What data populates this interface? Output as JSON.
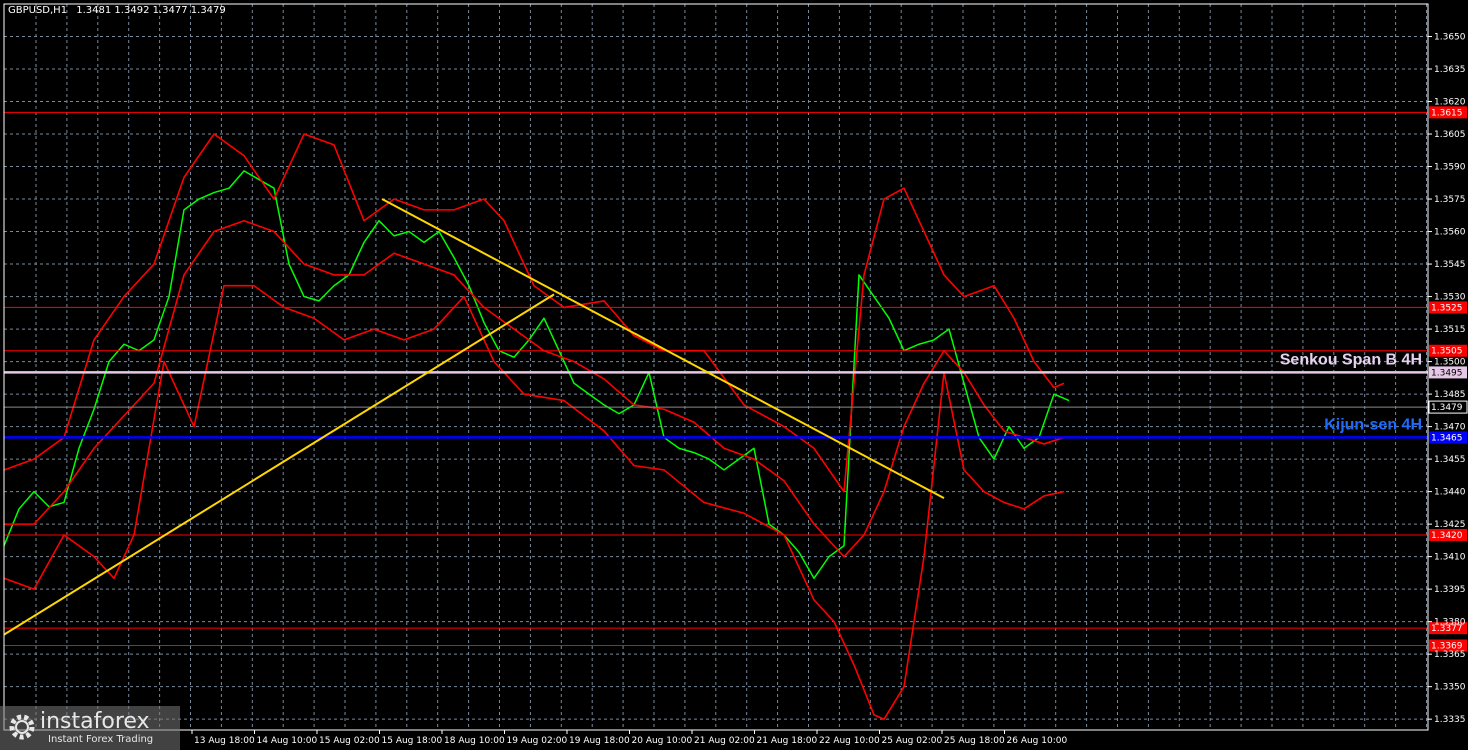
{
  "header": {
    "symbol": "GBPUSD,H1",
    "ohlc": "1.3481 1.3492 1.3477 1.3479"
  },
  "watermark": {
    "brand": "instaforex",
    "tagline": "Instant Forex Trading",
    "icon": "gear-logo-icon"
  },
  "chart_data": {
    "type": "line",
    "symbol": "GBPUSD",
    "timeframe": "H1",
    "ylim": [
      1.333,
      1.3665
    ],
    "y_ticks": [
      1.3335,
      1.335,
      1.3365,
      1.338,
      1.3395,
      1.341,
      1.3425,
      1.344,
      1.3455,
      1.347,
      1.3485,
      1.35,
      1.3515,
      1.353,
      1.3545,
      1.356,
      1.3575,
      1.359,
      1.3605,
      1.362,
      1.3635,
      1.365
    ],
    "y_tick_labels": [
      "1.3335",
      "1.3350",
      "1.3365",
      "1.3380",
      "1.3395",
      "1.3410",
      "1.3425",
      "1.3440",
      "1.3455",
      "1.3470",
      "1.3485",
      "1.3500",
      "1.3515",
      "1.3530",
      "1.3545",
      "1.3560",
      "1.3575",
      "1.3590",
      "1.3605",
      "1.3620",
      "1.3635",
      "1.3650"
    ],
    "x_tick_labels": [
      "13 Aug 18:00",
      "14 Aug 10:00",
      "15 Aug 02:00",
      "15 Aug 18:00",
      "18 Aug 10:00",
      "19 Aug 02:00",
      "19 Aug 18:00",
      "20 Aug 10:00",
      "21 Aug 02:00",
      "21 Aug 18:00",
      "22 Aug 10:00",
      "25 Aug 02:00",
      "25 Aug 18:00",
      "26 Aug 10:00"
    ],
    "grid": true,
    "horizontal_levels": [
      {
        "value": 1.3615,
        "label": "1.3615",
        "color": "#ff0000"
      },
      {
        "value": 1.3525,
        "label": "1.3525",
        "color": "#ff0000"
      },
      {
        "value": 1.3505,
        "label": "1.3505",
        "color": "#ff0000"
      },
      {
        "value": 1.3495,
        "label": "1.3495",
        "color": "#e6c8e6",
        "name": "Senkou Span B 4H"
      },
      {
        "value": 1.3465,
        "label": "1.3465",
        "color": "#0000ff",
        "name": "Kijun-sen 4H"
      },
      {
        "value": 1.342,
        "label": "1.3420",
        "color": "#ff0000"
      },
      {
        "value": 1.3377,
        "label": "1.3377",
        "color": "#ff0000"
      },
      {
        "value": 1.3369,
        "label": "1.3369",
        "color": "#ff0000"
      }
    ],
    "current_price": {
      "value": 1.3479,
      "label": "1.3479"
    },
    "trend_lines": [
      {
        "color": "#ffd700",
        "points": [
          [
            0,
            1.3374
          ],
          [
            550,
            1.3531
          ]
        ]
      },
      {
        "color": "#ffd700",
        "points": [
          [
            378,
            1.3575
          ],
          [
            940,
            1.3437
          ]
        ]
      }
    ],
    "series": [
      {
        "role": "price",
        "color": "#00ff00",
        "x": [
          0,
          15,
          30,
          45,
          60,
          75,
          90,
          105,
          120,
          135,
          150,
          165,
          180,
          195,
          210,
          225,
          240,
          255,
          270,
          285,
          300,
          315,
          330,
          345,
          360,
          375,
          390,
          405,
          420,
          435,
          450,
          465,
          480,
          495,
          510,
          525,
          540,
          555,
          570,
          585,
          600,
          615,
          630,
          645,
          660,
          675,
          690,
          705,
          720,
          735,
          750,
          765,
          780,
          795,
          810,
          825,
          840,
          855,
          870,
          885,
          900,
          915,
          930,
          945,
          960,
          975,
          990,
          1005,
          1020,
          1035,
          1050,
          1065
        ],
        "y": [
          1.3415,
          1.3432,
          1.344,
          1.3433,
          1.3435,
          1.346,
          1.3478,
          1.35,
          1.3508,
          1.3505,
          1.351,
          1.353,
          1.357,
          1.3575,
          1.3578,
          1.358,
          1.3588,
          1.3584,
          1.358,
          1.3545,
          1.353,
          1.3528,
          1.3535,
          1.354,
          1.3555,
          1.3565,
          1.3558,
          1.356,
          1.3555,
          1.356,
          1.3548,
          1.3535,
          1.3518,
          1.3505,
          1.3502,
          1.351,
          1.352,
          1.3505,
          1.349,
          1.3485,
          1.348,
          1.3476,
          1.348,
          1.3495,
          1.3465,
          1.346,
          1.3458,
          1.3455,
          1.345,
          1.3455,
          1.346,
          1.3425,
          1.342,
          1.3412,
          1.34,
          1.341,
          1.3415,
          1.354,
          1.353,
          1.352,
          1.3505,
          1.3508,
          1.351,
          1.3515,
          1.349,
          1.3465,
          1.3455,
          1.347,
          1.346,
          1.3465,
          1.3485,
          1.3482
        ]
      },
      {
        "role": "bollinger-upper",
        "color": "#ff0000",
        "x": [
          0,
          30,
          60,
          90,
          120,
          150,
          180,
          210,
          240,
          270,
          300,
          330,
          360,
          390,
          420,
          450,
          480,
          500,
          530,
          560,
          600,
          630,
          660,
          700,
          740,
          780,
          810,
          840,
          860,
          880,
          900,
          920,
          940,
          960,
          990,
          1010,
          1030,
          1050,
          1060
        ],
        "y": [
          1.345,
          1.3455,
          1.3465,
          1.351,
          1.353,
          1.3545,
          1.3585,
          1.3605,
          1.3595,
          1.3575,
          1.3605,
          1.36,
          1.3565,
          1.3575,
          1.357,
          1.357,
          1.3575,
          1.3565,
          1.3535,
          1.3525,
          1.3528,
          1.3512,
          1.3505,
          1.3505,
          1.348,
          1.347,
          1.346,
          1.344,
          1.354,
          1.3575,
          1.358,
          1.356,
          1.354,
          1.353,
          1.3535,
          1.352,
          1.35,
          1.3488,
          1.349
        ]
      },
      {
        "role": "bollinger-lower",
        "color": "#ff0000",
        "x": [
          0,
          30,
          60,
          90,
          110,
          130,
          160,
          190,
          220,
          250,
          280,
          310,
          340,
          370,
          400,
          430,
          460,
          490,
          520,
          560,
          600,
          630,
          660,
          700,
          740,
          780,
          810,
          830,
          850,
          870,
          880,
          900,
          920,
          940,
          960,
          980,
          1000,
          1020,
          1040,
          1060
        ],
        "y": [
          1.34,
          1.3395,
          1.342,
          1.341,
          1.34,
          1.342,
          1.35,
          1.347,
          1.3535,
          1.3535,
          1.3525,
          1.352,
          1.351,
          1.3515,
          1.351,
          1.3515,
          1.353,
          1.35,
          1.3485,
          1.3482,
          1.3468,
          1.3452,
          1.345,
          1.3435,
          1.343,
          1.342,
          1.339,
          1.338,
          1.336,
          1.3337,
          1.3335,
          1.335,
          1.341,
          1.3495,
          1.345,
          1.344,
          1.3435,
          1.3432,
          1.3438,
          1.344
        ]
      },
      {
        "role": "bollinger-middle",
        "color": "#ff0000",
        "x": [
          0,
          30,
          60,
          90,
          120,
          150,
          180,
          210,
          240,
          270,
          300,
          330,
          360,
          390,
          420,
          450,
          480,
          510,
          540,
          570,
          600,
          630,
          660,
          690,
          720,
          750,
          780,
          810,
          840,
          860,
          880,
          900,
          920,
          940,
          960,
          980,
          1000,
          1020,
          1040,
          1060
        ],
        "y": [
          1.3425,
          1.3425,
          1.344,
          1.346,
          1.3475,
          1.349,
          1.354,
          1.356,
          1.3565,
          1.356,
          1.3545,
          1.354,
          1.354,
          1.355,
          1.3545,
          1.354,
          1.3525,
          1.3515,
          1.3505,
          1.35,
          1.3492,
          1.348,
          1.3478,
          1.3472,
          1.346,
          1.3455,
          1.3445,
          1.3425,
          1.341,
          1.342,
          1.344,
          1.347,
          1.349,
          1.3505,
          1.3495,
          1.348,
          1.3468,
          1.3465,
          1.3462,
          1.3465
        ]
      }
    ]
  }
}
